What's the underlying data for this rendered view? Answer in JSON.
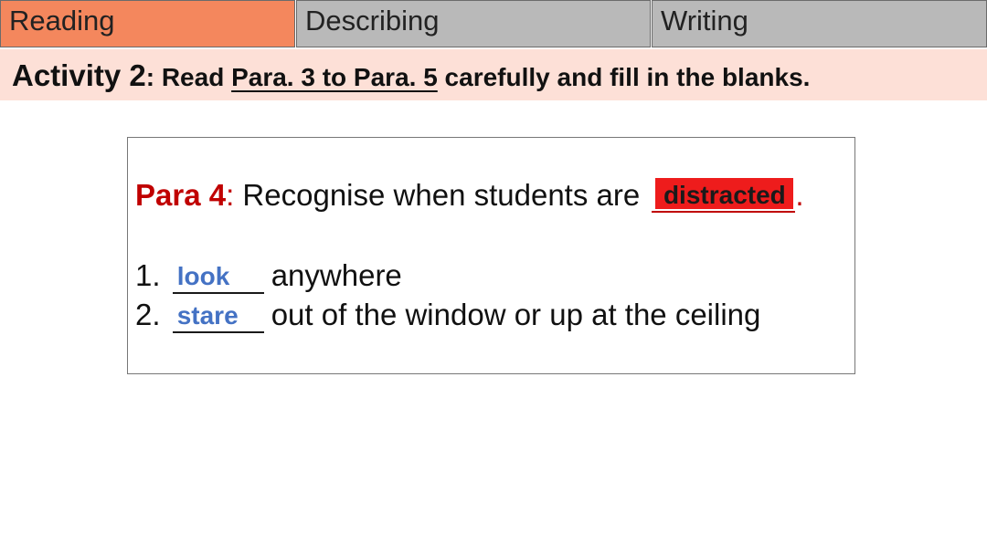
{
  "tabs": [
    {
      "label": "Reading",
      "active": true,
      "color": "#f4875d"
    },
    {
      "label": "Describing",
      "active": false,
      "color": "#b9b9b9"
    },
    {
      "label": "Writing",
      "active": false,
      "color": "#b9b9b9"
    }
  ],
  "activity": {
    "title": "Activity 2",
    "instruction_prefix": ": Read ",
    "instruction_underlined": "Para. 3 to Para. 5",
    "instruction_suffix": " carefully and fill in the blanks.",
    "background_color": "#fde0d7"
  },
  "card": {
    "para_label": "Para 4",
    "colon": ":",
    "sentence": " Recognise when students are ",
    "answer_main": "distracted",
    "period": ".",
    "items": [
      {
        "number": "1.",
        "answer": "look",
        "text": "anywhere"
      },
      {
        "number": "2.",
        "answer": "stare",
        "text": "out of the window or up at the ceiling"
      }
    ],
    "accent_red": "#c00000",
    "answer_blue": "#4472c4"
  }
}
